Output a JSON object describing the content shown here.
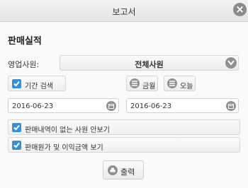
{
  "window": {
    "title": "보고서",
    "close_icon": "close-icon"
  },
  "section": {
    "title": "판매실적"
  },
  "salesperson": {
    "label": "영업사원:",
    "selected": "전체사원"
  },
  "period": {
    "checkbox_label": "기간 검색",
    "checked": true,
    "this_month_label": "금월",
    "today_label": "오늘",
    "start_date": "2016-06-23",
    "end_date": "2016-06-23"
  },
  "options": {
    "show_no_sales": {
      "label": "판매내역이 없는 사원 안보기",
      "checked": true
    },
    "show_cost_profit": {
      "label": "판매원가 및 이익금액 보기",
      "checked": true
    }
  },
  "actions": {
    "print_label": "출력"
  },
  "colors": {
    "accent": "#3a8fd4",
    "icon_gray": "#8f8f8f"
  }
}
